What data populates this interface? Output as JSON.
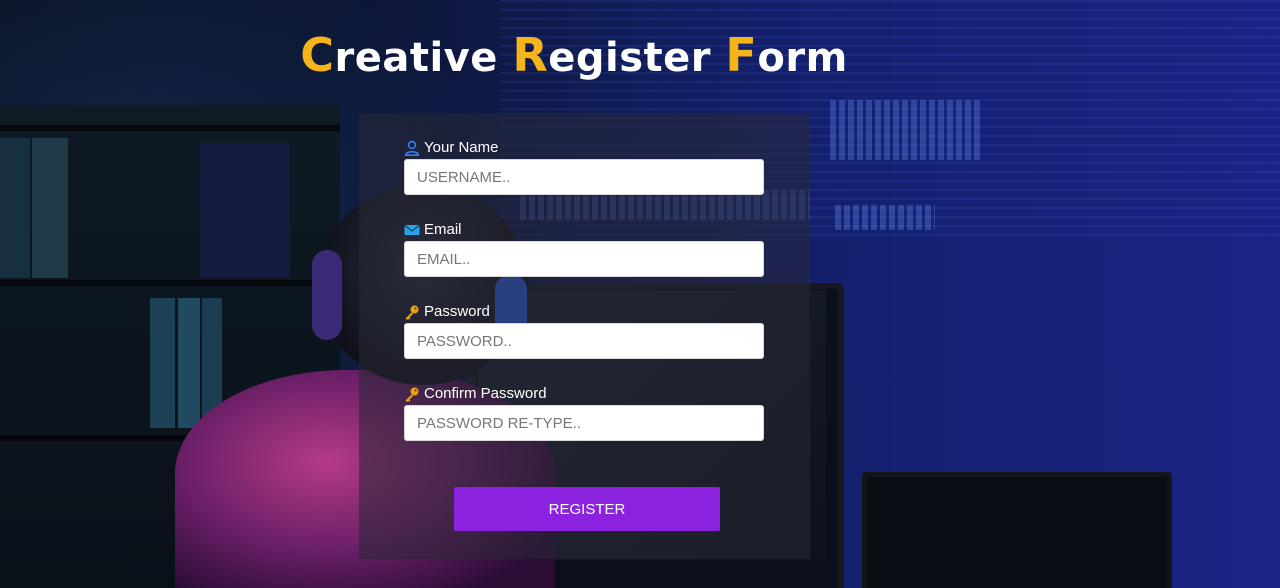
{
  "title": {
    "c1": "C",
    "rest1": "reative ",
    "c2": "R",
    "rest2": "egister ",
    "c3": "F",
    "rest3": "orm"
  },
  "form": {
    "fields": [
      {
        "label": "Your Name",
        "icon": "user-icon",
        "placeholder": "USERNAME.."
      },
      {
        "label": "Email",
        "icon": "envelope-icon",
        "placeholder": "EMAIL.."
      },
      {
        "label": "Password",
        "icon": "key-icon",
        "placeholder": "PASSWORD.."
      },
      {
        "label": "Confirm Password",
        "icon": "key-icon",
        "placeholder": "PASSWORD RE-TYPE.."
      }
    ],
    "submit_label": "REGISTER"
  },
  "colors": {
    "title_accent": "#f4b41a",
    "button": "#8a22e0",
    "user_icon": "#3a7bf0",
    "envelope_icon": "#29a3e8",
    "key_icon": "#e8a317"
  }
}
